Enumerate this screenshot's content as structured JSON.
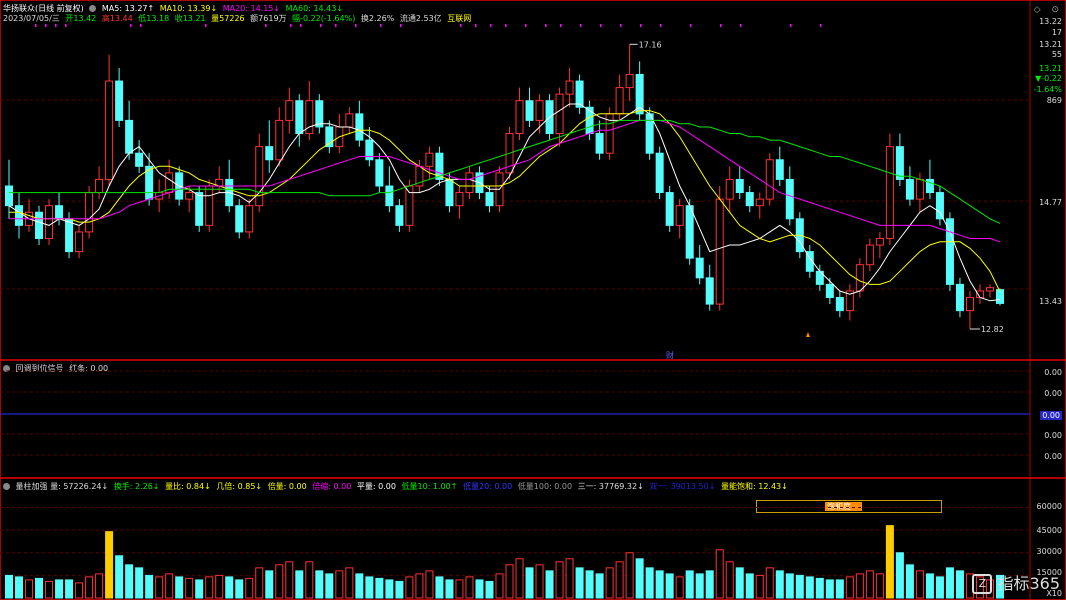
{
  "main": {
    "stock_name": "华扬联众(日线 前复权)",
    "ma5": "MA5: 13.27↑",
    "ma10": "MA10: 13.39↓",
    "ma20": "MA20: 14.15↓",
    "ma60": "MA60: 14.43↓",
    "date": "2023/07/05/三",
    "open": "开13.42",
    "high": "高13.44",
    "low": "低13.18",
    "close": "收13.21",
    "volume": "量57226",
    "amount": "额7619万",
    "change": "幅-0.22(-1.64%)",
    "turnover": "换2.26%",
    "float": "流通2.53亿",
    "concept": "互联网",
    "high_label": "17.16",
    "low_label": "12.82",
    "event_label": "财",
    "axis": [
      "13.22",
      "17",
      "13.21",
      "55",
      "13.21",
      "▼-0.22",
      "-1.64%",
      "869",
      "14.77",
      "13.43"
    ]
  },
  "panel2": {
    "title": "回调到位信号",
    "value": "红条: 0.00",
    "axis": [
      "0.00",
      "0.00",
      "0.00",
      "0.00",
      "0.00"
    ]
  },
  "panel3": {
    "items": [
      "量柱加强 量: 57226.24↓",
      "换手: 2.26↓",
      "量比: 0.84↓",
      "几倍: 0.85↓",
      "倍量: 0.00",
      "倍缩: 0.00",
      "平量: 0.00",
      "低量10: 1.00↑",
      "低量20: 0.00",
      "低量100: 0.00",
      "三一: 37769.32↓",
      "双一: 39013.50↓",
      "量能饱和: 12.43↓"
    ],
    "badge": "饱和度",
    "axis": [
      "60000",
      "45000",
      "30000",
      "15000",
      "X10"
    ]
  },
  "watermark": "指标365",
  "colors": {
    "up": "#ff3232",
    "down": "#54fcfc",
    "ma5": "#ffffff",
    "ma10": "#ffff00",
    "ma20": "#ff00ff",
    "ma60": "#00e600",
    "frame": "#b00000"
  },
  "chart_data": {
    "type": "candlestick",
    "ylim": [
      12.5,
      17.5
    ],
    "candles": [
      [
        15.0,
        15.4,
        14.5,
        14.7
      ],
      [
        14.7,
        14.9,
        14.2,
        14.4
      ],
      [
        14.4,
        14.8,
        14.3,
        14.6
      ],
      [
        14.6,
        14.7,
        14.1,
        14.2
      ],
      [
        14.2,
        14.8,
        14.1,
        14.7
      ],
      [
        14.7,
        14.9,
        14.4,
        14.5
      ],
      [
        14.5,
        14.6,
        13.9,
        14.0
      ],
      [
        14.0,
        14.4,
        13.9,
        14.3
      ],
      [
        14.3,
        15.0,
        14.2,
        14.9
      ],
      [
        14.9,
        15.3,
        14.8,
        15.1
      ],
      [
        15.1,
        17.0,
        15.0,
        16.6
      ],
      [
        16.6,
        16.8,
        15.9,
        16.0
      ],
      [
        16.0,
        16.3,
        15.4,
        15.5
      ],
      [
        15.5,
        15.7,
        15.2,
        15.3
      ],
      [
        15.3,
        15.5,
        14.7,
        14.8
      ],
      [
        14.8,
        15.1,
        14.6,
        14.9
      ],
      [
        14.9,
        15.4,
        14.8,
        15.2
      ],
      [
        15.2,
        15.3,
        14.7,
        14.8
      ],
      [
        14.8,
        15.0,
        14.6,
        14.9
      ],
      [
        14.9,
        15.0,
        14.3,
        14.4
      ],
      [
        14.4,
        15.1,
        14.3,
        15.0
      ],
      [
        15.0,
        15.3,
        14.9,
        15.1
      ],
      [
        15.1,
        15.4,
        14.6,
        14.7
      ],
      [
        14.7,
        14.8,
        14.2,
        14.3
      ],
      [
        14.3,
        14.8,
        14.2,
        14.7
      ],
      [
        14.7,
        15.8,
        14.6,
        15.6
      ],
      [
        15.6,
        16.0,
        15.2,
        15.4
      ],
      [
        15.4,
        16.2,
        15.3,
        16.0
      ],
      [
        16.0,
        16.5,
        15.8,
        16.3
      ],
      [
        16.3,
        16.4,
        15.6,
        15.8
      ],
      [
        15.8,
        16.6,
        15.7,
        16.3
      ],
      [
        16.3,
        16.4,
        15.8,
        15.9
      ],
      [
        15.9,
        16.0,
        15.5,
        15.6
      ],
      [
        15.6,
        16.1,
        15.5,
        15.9
      ],
      [
        15.9,
        16.2,
        15.8,
        16.1
      ],
      [
        16.1,
        16.3,
        15.6,
        15.7
      ],
      [
        15.7,
        15.9,
        15.3,
        15.4
      ],
      [
        15.4,
        15.5,
        14.9,
        15.0
      ],
      [
        15.0,
        15.3,
        14.6,
        14.7
      ],
      [
        14.7,
        14.8,
        14.3,
        14.4
      ],
      [
        14.4,
        15.1,
        14.3,
        15.0
      ],
      [
        15.0,
        15.4,
        14.9,
        15.3
      ],
      [
        15.3,
        15.6,
        15.1,
        15.5
      ],
      [
        15.5,
        15.6,
        15.0,
        15.1
      ],
      [
        15.1,
        15.2,
        14.6,
        14.7
      ],
      [
        14.7,
        15.0,
        14.5,
        14.9
      ],
      [
        14.9,
        15.3,
        14.8,
        15.2
      ],
      [
        15.2,
        15.3,
        14.8,
        14.9
      ],
      [
        14.9,
        15.0,
        14.6,
        14.7
      ],
      [
        14.7,
        15.3,
        14.6,
        15.2
      ],
      [
        15.2,
        15.9,
        15.1,
        15.8
      ],
      [
        15.8,
        16.5,
        15.7,
        16.3
      ],
      [
        16.3,
        16.5,
        15.9,
        16.0
      ],
      [
        16.0,
        16.4,
        15.8,
        16.3
      ],
      [
        16.3,
        16.4,
        15.7,
        15.8
      ],
      [
        15.8,
        16.5,
        15.6,
        16.4
      ],
      [
        16.4,
        16.8,
        16.2,
        16.6
      ],
      [
        16.6,
        16.7,
        16.1,
        16.2
      ],
      [
        16.2,
        16.3,
        15.7,
        15.8
      ],
      [
        15.8,
        16.0,
        15.4,
        15.5
      ],
      [
        15.5,
        16.2,
        15.4,
        16.1
      ],
      [
        16.1,
        16.7,
        16.0,
        16.5
      ],
      [
        16.5,
        17.16,
        16.3,
        16.7
      ],
      [
        16.7,
        16.9,
        16.0,
        16.1
      ],
      [
        16.1,
        16.2,
        15.4,
        15.5
      ],
      [
        15.5,
        15.6,
        14.8,
        14.9
      ],
      [
        14.9,
        15.0,
        14.3,
        14.4
      ],
      [
        14.4,
        14.8,
        14.2,
        14.7
      ],
      [
        14.7,
        14.8,
        13.8,
        13.9
      ],
      [
        13.9,
        14.1,
        13.5,
        13.6
      ],
      [
        13.6,
        13.8,
        13.1,
        13.2
      ],
      [
        13.2,
        15.0,
        13.1,
        14.8
      ],
      [
        14.8,
        15.3,
        14.6,
        15.1
      ],
      [
        15.1,
        15.3,
        14.8,
        14.9
      ],
      [
        14.9,
        15.0,
        14.6,
        14.7
      ],
      [
        14.7,
        14.9,
        14.5,
        14.8
      ],
      [
        14.8,
        15.5,
        14.7,
        15.4
      ],
      [
        15.4,
        15.6,
        15.0,
        15.1
      ],
      [
        15.1,
        15.3,
        14.4,
        14.5
      ],
      [
        14.5,
        14.6,
        13.9,
        14.0
      ],
      [
        14.0,
        14.1,
        13.6,
        13.7
      ],
      [
        13.7,
        13.8,
        13.4,
        13.5
      ],
      [
        13.5,
        13.6,
        13.2,
        13.3
      ],
      [
        13.3,
        13.4,
        13.0,
        13.1
      ],
      [
        13.1,
        13.5,
        12.95,
        13.4
      ],
      [
        13.4,
        13.9,
        13.3,
        13.8
      ],
      [
        13.8,
        14.2,
        13.7,
        14.1
      ],
      [
        14.1,
        14.3,
        13.9,
        14.2
      ],
      [
        14.2,
        15.8,
        14.1,
        15.6
      ],
      [
        15.6,
        15.8,
        15.0,
        15.1
      ],
      [
        15.1,
        15.3,
        14.7,
        14.8
      ],
      [
        14.8,
        15.2,
        14.6,
        15.1
      ],
      [
        15.1,
        15.4,
        14.8,
        14.9
      ],
      [
        14.9,
        15.0,
        14.4,
        14.5
      ],
      [
        14.5,
        14.6,
        13.4,
        13.5
      ],
      [
        13.5,
        13.6,
        13.0,
        13.1
      ],
      [
        13.1,
        13.4,
        12.82,
        13.3
      ],
      [
        13.3,
        13.5,
        13.2,
        13.4
      ],
      [
        13.4,
        13.5,
        13.3,
        13.45
      ],
      [
        13.42,
        13.44,
        13.18,
        13.21
      ]
    ],
    "ma5": [
      14.7,
      14.6,
      14.5,
      14.45,
      14.4,
      14.5,
      14.45,
      14.4,
      14.5,
      14.65,
      15.0,
      15.3,
      15.5,
      15.6,
      15.4,
      15.2,
      15.1,
      15.0,
      14.95,
      14.85,
      14.85,
      14.9,
      14.9,
      14.85,
      14.75,
      14.9,
      15.1,
      15.35,
      15.6,
      15.8,
      15.9,
      15.95,
      15.95,
      15.9,
      15.9,
      15.85,
      15.75,
      15.6,
      15.4,
      15.1,
      14.9,
      14.9,
      14.95,
      15.05,
      15.1,
      15.1,
      15.1,
      15.05,
      14.95,
      14.95,
      15.15,
      15.45,
      15.75,
      15.9,
      16.05,
      16.15,
      16.25,
      16.25,
      16.15,
      16.05,
      16.0,
      16.0,
      16.1,
      16.2,
      16.1,
      15.8,
      15.4,
      15.0,
      14.7,
      14.35,
      14.0,
      14.05,
      14.1,
      14.1,
      14.15,
      14.2,
      14.3,
      14.4,
      14.3,
      14.15,
      13.9,
      13.7,
      13.55,
      13.4,
      13.35,
      13.4,
      13.55,
      13.75,
      14.0,
      14.2,
      14.4,
      14.6,
      14.7,
      14.6,
      14.3,
      13.9,
      13.55,
      13.3,
      13.25,
      13.27
    ],
    "ma10": [
      14.6,
      14.6,
      14.55,
      14.5,
      14.5,
      14.5,
      14.5,
      14.45,
      14.45,
      14.5,
      14.6,
      14.8,
      15.0,
      15.15,
      15.25,
      15.3,
      15.3,
      15.25,
      15.2,
      15.1,
      15.05,
      15.0,
      14.95,
      14.9,
      14.85,
      14.85,
      14.9,
      15.0,
      15.1,
      15.25,
      15.4,
      15.55,
      15.65,
      15.75,
      15.8,
      15.85,
      15.85,
      15.8,
      15.7,
      15.55,
      15.4,
      15.3,
      15.2,
      15.15,
      15.1,
      15.0,
      15.0,
      15.0,
      15.0,
      15.0,
      15.05,
      15.15,
      15.3,
      15.45,
      15.55,
      15.65,
      15.8,
      15.95,
      16.05,
      16.1,
      16.1,
      16.1,
      16.1,
      16.15,
      16.15,
      16.1,
      15.95,
      15.75,
      15.5,
      15.25,
      15.0,
      14.8,
      14.6,
      14.4,
      14.3,
      14.2,
      14.15,
      14.2,
      14.25,
      14.25,
      14.2,
      14.1,
      13.95,
      13.8,
      13.65,
      13.55,
      13.5,
      13.5,
      13.55,
      13.7,
      13.85,
      14.0,
      14.1,
      14.15,
      14.15,
      14.15,
      14.05,
      13.9,
      13.7,
      13.39
    ],
    "ma20": [
      14.5,
      14.5,
      14.5,
      14.5,
      14.5,
      14.5,
      14.5,
      14.5,
      14.5,
      14.5,
      14.55,
      14.6,
      14.7,
      14.75,
      14.8,
      14.85,
      14.9,
      14.95,
      15.0,
      15.0,
      15.0,
      15.0,
      15.0,
      15.0,
      15.0,
      15.0,
      15.0,
      15.05,
      15.1,
      15.15,
      15.2,
      15.25,
      15.3,
      15.35,
      15.4,
      15.45,
      15.45,
      15.45,
      15.45,
      15.4,
      15.35,
      15.3,
      15.25,
      15.2,
      15.15,
      15.1,
      15.1,
      15.15,
      15.2,
      15.25,
      15.3,
      15.35,
      15.4,
      15.5,
      15.6,
      15.65,
      15.7,
      15.75,
      15.8,
      15.85,
      15.85,
      15.9,
      15.95,
      16.0,
      16.0,
      16.0,
      15.95,
      15.9,
      15.8,
      15.7,
      15.6,
      15.5,
      15.4,
      15.3,
      15.2,
      15.1,
      15.0,
      14.9,
      14.85,
      14.8,
      14.75,
      14.7,
      14.65,
      14.6,
      14.55,
      14.5,
      14.45,
      14.4,
      14.4,
      14.4,
      14.4,
      14.4,
      14.4,
      14.35,
      14.3,
      14.25,
      14.2,
      14.2,
      14.2,
      14.15
    ],
    "ma60": [
      14.9,
      14.9,
      14.9,
      14.9,
      14.9,
      14.9,
      14.9,
      14.9,
      14.9,
      14.9,
      14.9,
      14.9,
      14.9,
      14.9,
      14.9,
      14.9,
      14.95,
      14.95,
      14.95,
      14.95,
      14.95,
      14.95,
      14.95,
      14.95,
      14.95,
      14.9,
      14.9,
      14.9,
      14.9,
      14.9,
      14.9,
      14.9,
      14.85,
      14.85,
      14.85,
      14.85,
      14.85,
      14.9,
      14.9,
      14.95,
      15.0,
      15.05,
      15.1,
      15.15,
      15.2,
      15.25,
      15.3,
      15.35,
      15.4,
      15.45,
      15.5,
      15.55,
      15.6,
      15.65,
      15.7,
      15.75,
      15.8,
      15.85,
      15.9,
      15.95,
      15.95,
      16.0,
      16.0,
      16.0,
      16.0,
      16.0,
      16.0,
      15.95,
      15.95,
      15.9,
      15.9,
      15.85,
      15.8,
      15.8,
      15.75,
      15.75,
      15.7,
      15.7,
      15.65,
      15.6,
      15.55,
      15.5,
      15.45,
      15.45,
      15.4,
      15.35,
      15.3,
      15.25,
      15.2,
      15.15,
      15.15,
      15.1,
      15.05,
      15.0,
      14.9,
      14.8,
      14.7,
      14.6,
      14.5,
      14.43
    ],
    "volume": [
      15000,
      14000,
      12000,
      13000,
      11000,
      12000,
      12000,
      10000,
      14000,
      16000,
      44000,
      28000,
      22000,
      20000,
      15000,
      14000,
      16000,
      14000,
      13000,
      12000,
      14000,
      15000,
      14000,
      12000,
      13000,
      20000,
      18000,
      22000,
      24000,
      18000,
      24000,
      18000,
      16000,
      18000,
      20000,
      16000,
      14000,
      13000,
      12000,
      11000,
      14000,
      16000,
      18000,
      14000,
      12000,
      12000,
      14000,
      12000,
      11000,
      16000,
      22000,
      26000,
      20000,
      22000,
      18000,
      24000,
      26000,
      20000,
      18000,
      16000,
      20000,
      24000,
      30000,
      26000,
      20000,
      18000,
      16000,
      14000,
      18000,
      16000,
      18000,
      32000,
      24000,
      20000,
      16000,
      15000,
      20000,
      18000,
      16000,
      15000,
      14000,
      13000,
      12000,
      12000,
      14000,
      16000,
      18000,
      16000,
      48000,
      30000,
      22000,
      18000,
      16000,
      14000,
      20000,
      18000,
      16000,
      14000,
      12000,
      15000
    ]
  }
}
